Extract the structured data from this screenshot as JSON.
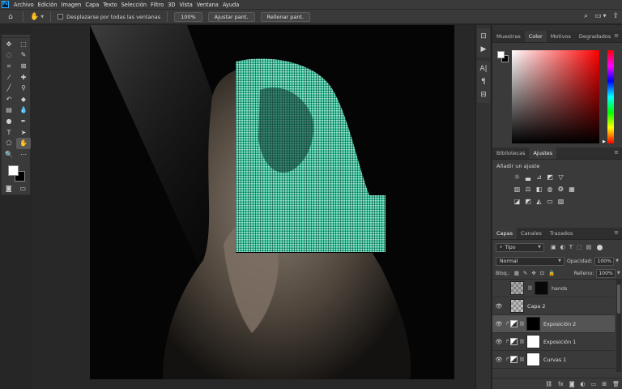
{
  "menu": {
    "logo": "Ps",
    "items": [
      "Archivo",
      "Edición",
      "Imagen",
      "Capa",
      "Texto",
      "Selección",
      "Filtro",
      "3D",
      "Vista",
      "Ventana",
      "Ayuda"
    ]
  },
  "options": {
    "scroll_all_label": "Desplazarse por todas las ventanas",
    "zoom_value": "100%",
    "fit_screen": "Ajustar pant.",
    "fill_screen": "Rellenar pant."
  },
  "color_panel": {
    "tabs": [
      "Muestras",
      "Color",
      "Motivos",
      "Degradados"
    ],
    "active_tab": "Color",
    "foreground": "#ffffff",
    "background": "#000000",
    "hue": "#ff0000"
  },
  "adjust_panel": {
    "tabs": [
      "Bibliotecas",
      "Ajustes"
    ],
    "active_tab": "Ajustes",
    "title": "Añadir un ajuste"
  },
  "layers_panel": {
    "tabs": [
      "Capas",
      "Canales",
      "Trazados"
    ],
    "active_tab": "Capas",
    "filter_kind": "Tipo",
    "blend_mode": "Normal",
    "opacity_label": "Opacidad:",
    "opacity_value": "100%",
    "lock_label": "Bloq.:",
    "fill_label": "Relleno:",
    "fill_value": "100%",
    "layers": [
      {
        "name": "hands",
        "visible": false,
        "selected": false
      },
      {
        "name": "Capa 2",
        "visible": true,
        "selected": false
      },
      {
        "name": "Exposición 2",
        "visible": true,
        "selected": true
      },
      {
        "name": "Exposición 1",
        "visible": true,
        "selected": false
      },
      {
        "name": "Curvas 1",
        "visible": true,
        "selected": false
      }
    ]
  },
  "footer": {
    "fx_label": "fx"
  }
}
